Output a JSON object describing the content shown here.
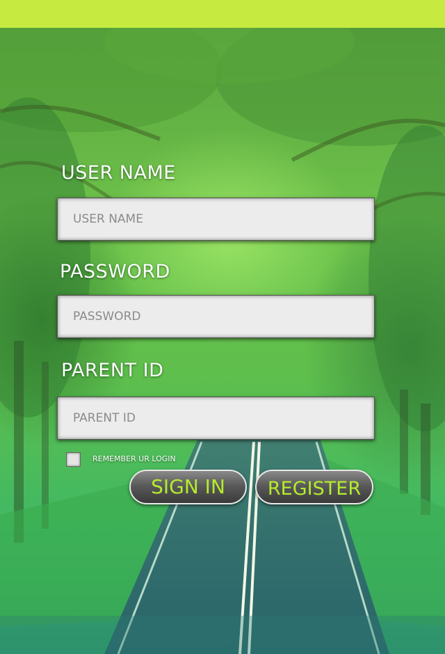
{
  "form": {
    "username": {
      "label": "USER NAME",
      "placeholder": "USER NAME",
      "value": ""
    },
    "password": {
      "label": "PASSWORD",
      "placeholder": "PASSWORD",
      "value": ""
    },
    "parent_id": {
      "label": "PARENT ID",
      "placeholder": "PARENT ID",
      "value": ""
    },
    "remember_label": "REMEMBER UR LOGIN",
    "remember_checked": false
  },
  "buttons": {
    "sign_in": "SIGN IN",
    "register": "REGISTER"
  },
  "theme": {
    "accent": "#c6ea3f",
    "button_text": "#b5ec2c",
    "field_bg": "#ececec"
  },
  "background": {
    "scene": "tree-lined-road"
  }
}
